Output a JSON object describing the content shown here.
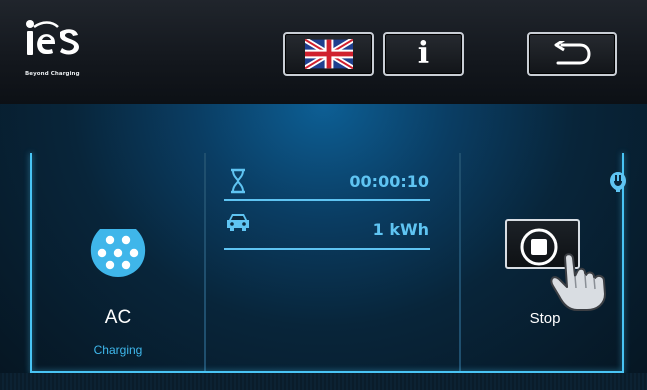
{
  "header": {
    "logo": {
      "brand": "ies",
      "tagline": "Beyond Charging"
    },
    "buttons": {
      "language": {
        "icon": "uk-flag-icon"
      },
      "info": {
        "icon": "info-icon",
        "glyph": "i"
      },
      "back": {
        "icon": "return-arrow-icon"
      }
    }
  },
  "session": {
    "connector": {
      "icon": "type2-connector-icon",
      "type": "AC",
      "status": "Charging"
    },
    "duration": {
      "icon": "hourglass-icon",
      "value": "00:00:10"
    },
    "energy": {
      "icon": "car-icon",
      "value": "1 kWh"
    },
    "plug_indicator": {
      "icon": "plug-icon"
    },
    "stop": {
      "icon": "stop-icon",
      "pointer_icon": "hand-pointer-icon",
      "label": "Stop"
    }
  },
  "colors": {
    "accent": "#49c4f4",
    "value_text": "#5fc4f2",
    "panel_top": "#0d5f95",
    "background": "#0b1016"
  }
}
